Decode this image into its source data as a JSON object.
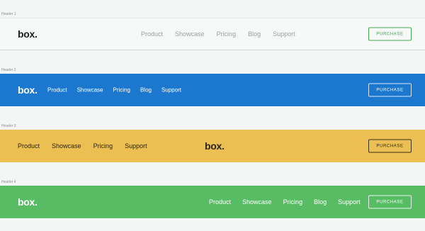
{
  "headers": [
    {
      "caption": "Header 1",
      "logo": "box.",
      "nav": [
        "Product",
        "Showcase",
        "Pricing",
        "Blog",
        "Support"
      ],
      "button": "PURCHASE",
      "background": "#f7f8f8",
      "accent": "#44a653"
    },
    {
      "caption": "Header 2",
      "logo": "box.",
      "nav": [
        "Product",
        "Showcase",
        "Pricing",
        "Blog",
        "Support"
      ],
      "button": "PURCHASE",
      "background": "#1c78cf",
      "accent": "#ffffff"
    },
    {
      "caption": "Header 3",
      "logo": "box.",
      "nav": [
        "Product",
        "Showcase",
        "Pricing",
        "Support"
      ],
      "button": "PURCHASE",
      "background": "#ecbf52",
      "accent": "#2b2511"
    },
    {
      "caption": "Header 4",
      "logo": "box.",
      "nav": [
        "Product",
        "Showcase",
        "Pricing",
        "Blog",
        "Support"
      ],
      "button": "PURCHASE",
      "background": "#58bc64",
      "accent": "#ffffff"
    }
  ]
}
